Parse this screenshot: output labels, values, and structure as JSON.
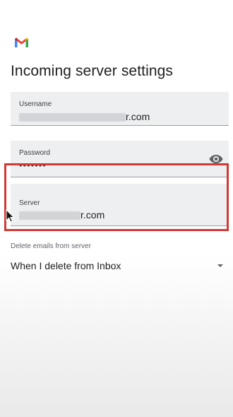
{
  "app": {
    "logo_icon": "gmail-icon",
    "brand_colors": [
      "#4285f4",
      "#ea4335",
      "#fbbc04",
      "#34a853",
      "#c5221f"
    ]
  },
  "page": {
    "title": "Incoming server settings"
  },
  "username": {
    "label": "Username",
    "value_suffix": "r.com"
  },
  "password": {
    "label": "Password",
    "value": "•••••••",
    "toggle_icon": "eye-icon"
  },
  "server": {
    "label": "Server",
    "value_suffix": "r.com"
  },
  "delete_setting": {
    "label": "Delete emails from server",
    "value": "When I delete from Inbox",
    "icon": "dropdown-arrow-icon"
  },
  "highlight": {
    "color": "#d13a35"
  }
}
